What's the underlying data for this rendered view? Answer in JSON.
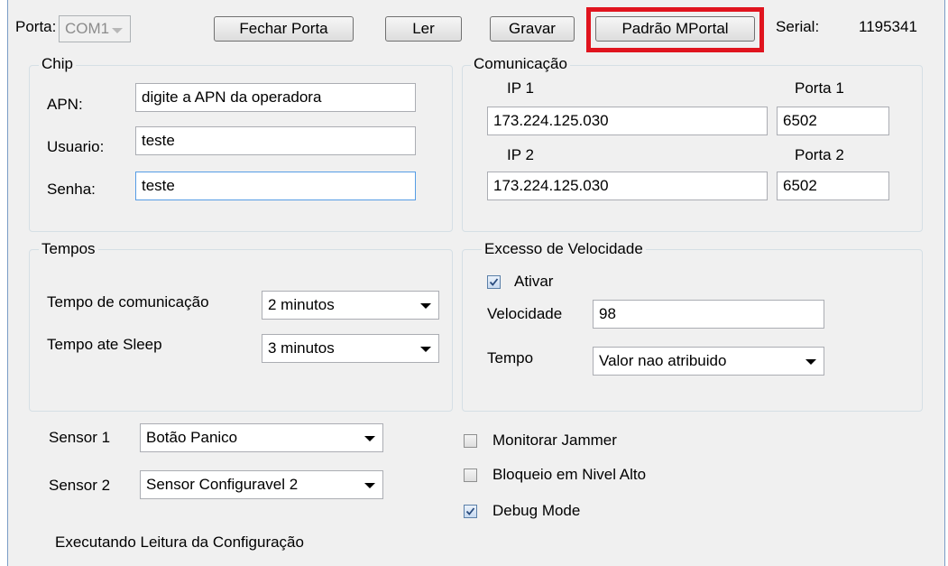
{
  "toolbar": {
    "porta_label": "Porta:",
    "porta_value": "COM1",
    "fechar_label": "Fechar Porta",
    "ler_label": "Ler",
    "gravar_label": "Gravar",
    "padrao_label": "Padrão MPortal",
    "serial_label": "Serial:",
    "serial_value": "1195341"
  },
  "chip": {
    "title": "Chip",
    "apn_label": "APN:",
    "apn_value": "digite a APN da operadora",
    "usuario_label": "Usuario:",
    "usuario_value": "teste",
    "senha_label": "Senha:",
    "senha_value": "teste"
  },
  "comunicacao": {
    "title": "Comunicação",
    "ip1_label": "IP 1",
    "ip1_value": "173.224.125.030",
    "porta1_label": "Porta 1",
    "porta1_value": "6502",
    "ip2_label": "IP 2",
    "ip2_value": "173.224.125.030",
    "porta2_label": "Porta 2",
    "porta2_value": "6502"
  },
  "tempos": {
    "title": "Tempos",
    "comunicacao_label": "Tempo de comunicação",
    "comunicacao_value": "2 minutos",
    "sleep_label": "Tempo ate Sleep",
    "sleep_value": "3 minutos"
  },
  "excesso": {
    "title": "Excesso de Velocidade",
    "ativar_label": "Ativar",
    "ativar_checked": true,
    "velocidade_label": "Velocidade",
    "velocidade_value": "98",
    "tempo_label": "Tempo",
    "tempo_value": "Valor nao atribuido"
  },
  "sensors": {
    "sensor1_label": "Sensor 1",
    "sensor1_value": "Botão Panico",
    "sensor2_label": "Sensor 2",
    "sensor2_value": "Sensor Configuravel 2"
  },
  "options": {
    "jammer_label": "Monitorar Jammer",
    "jammer_checked": false,
    "bloqueio_label": "Bloqueio em Nivel Alto",
    "bloqueio_checked": false,
    "debug_label": "Debug Mode",
    "debug_checked": true
  },
  "status": {
    "text": "Executando Leitura da Configuração"
  },
  "colors": {
    "highlight": "#e0141e",
    "focus_border": "#569de5"
  }
}
